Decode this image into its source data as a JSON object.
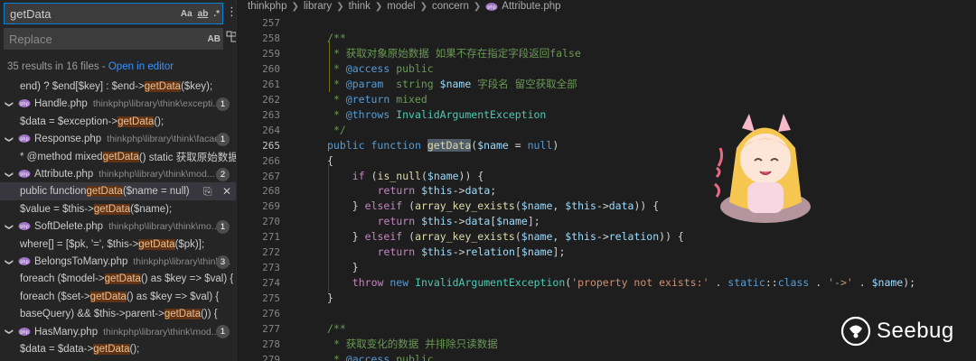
{
  "search": {
    "query": "getData",
    "replace_placeholder": "Replace",
    "toggle_case": "Aa",
    "toggle_word": "ab",
    "toggle_regex": ".*",
    "toggle_preserve_case": "AB",
    "summary": "35 results in 16 files - ",
    "open_in_editor": "Open in editor"
  },
  "results": [
    {
      "kind": "match",
      "pre": "end) ? $end[$key] : $end->",
      "hit": "getData",
      "post": "($key);"
    },
    {
      "kind": "file",
      "name": "Handle.php",
      "path": "thinkphp\\library\\think\\excepti...",
      "count": "1"
    },
    {
      "kind": "match",
      "pre": "$data = $exception->",
      "hit": "getData",
      "post": "();"
    },
    {
      "kind": "file",
      "name": "Response.php",
      "path": "thinkphp\\library\\think\\facade",
      "count": "1"
    },
    {
      "kind": "match",
      "pre": "* @method mixed ",
      "hit": "getData",
      "post": "() static 获取原始数据"
    },
    {
      "kind": "file",
      "name": "Attribute.php",
      "path": "thinkphp\\library\\think\\mod...",
      "count": "2"
    },
    {
      "kind": "match",
      "pre": "public function ",
      "hit": "getData",
      "post": "($name = null)",
      "selected": true
    },
    {
      "kind": "match",
      "pre": "$value    = $this->",
      "hit": "getData",
      "post": "($name);"
    },
    {
      "kind": "file",
      "name": "SoftDelete.php",
      "path": "thinkphp\\library\\think\\mo...",
      "count": "1"
    },
    {
      "kind": "match",
      "pre": "where[] = [$pk, '=', $this->",
      "hit": "getData",
      "post": "($pk)];"
    },
    {
      "kind": "file",
      "name": "BelongsToMany.php",
      "path": "thinkphp\\library\\think\\...",
      "count": "3"
    },
    {
      "kind": "match",
      "pre": "foreach ($model->",
      "hit": "getData",
      "post": "() as $key => $val) {"
    },
    {
      "kind": "match",
      "pre": "foreach ($set->",
      "hit": "getData",
      "post": "() as $key => $val) {"
    },
    {
      "kind": "match",
      "pre": "baseQuery) && $this->parent->",
      "hit": "getData",
      "post": "()) {"
    },
    {
      "kind": "file",
      "name": "HasMany.php",
      "path": "thinkphp\\library\\think\\mod...",
      "count": "1"
    },
    {
      "kind": "match",
      "pre": "$data = $data->",
      "hit": "getData",
      "post": "();"
    }
  ],
  "breadcrumb": [
    "thinkphp",
    "library",
    "think",
    "model",
    "concern",
    "Attribute.php"
  ],
  "editor": {
    "current_line": "265",
    "lines": [
      {
        "n": "257",
        "t": []
      },
      {
        "n": "258",
        "i": 0,
        "t": [
          [
            "cm",
            "/**"
          ]
        ]
      },
      {
        "n": "259",
        "i": 1,
        "t": [
          [
            "cm",
            "* 获取对象原始数据 如果不存在指定字段返回false"
          ]
        ]
      },
      {
        "n": "260",
        "i": 1,
        "t": [
          [
            "cm",
            "* "
          ],
          [
            "tg",
            "@access"
          ],
          [
            "cm",
            " public"
          ]
        ]
      },
      {
        "n": "261",
        "i": 1,
        "t": [
          [
            "cm",
            "* "
          ],
          [
            "tg",
            "@param"
          ],
          [
            "cm",
            "  string "
          ],
          [
            "vr",
            "$name"
          ],
          [
            "cm",
            " 字段名 留空获取全部"
          ]
        ]
      },
      {
        "n": "262",
        "i": 1,
        "t": [
          [
            "cm",
            "* "
          ],
          [
            "tg",
            "@return"
          ],
          [
            "cm",
            " mixed"
          ]
        ]
      },
      {
        "n": "263",
        "i": 1,
        "t": [
          [
            "cm",
            "* "
          ],
          [
            "tg",
            "@throws"
          ],
          [
            "ty",
            " InvalidArgumentException"
          ]
        ]
      },
      {
        "n": "264",
        "i": 1,
        "t": [
          [
            "cm",
            "*/"
          ]
        ]
      },
      {
        "n": "265",
        "i": 0,
        "t": [
          [
            "kw",
            "public"
          ],
          [
            "",
            " "
          ],
          [
            "kw",
            "function"
          ],
          [
            "",
            " "
          ],
          [
            "fn getdata-hl",
            "getData"
          ],
          [
            "",
            "("
          ],
          [
            "vr",
            "$name"
          ],
          [
            "",
            " = "
          ],
          [
            "kw",
            "null"
          ],
          [
            "",
            ")"
          ]
        ]
      },
      {
        "n": "266",
        "i": 0,
        "t": [
          [
            "",
            "{"
          ]
        ]
      },
      {
        "n": "267",
        "i": 4,
        "t": [
          [
            "ctl",
            "if"
          ],
          [
            "",
            " ("
          ],
          [
            "fn",
            "is_null"
          ],
          [
            "",
            "("
          ],
          [
            "vr",
            "$name"
          ],
          [
            "",
            ")) {"
          ]
        ]
      },
      {
        "n": "268",
        "i": 8,
        "t": [
          [
            "ctl",
            "return"
          ],
          [
            "",
            " "
          ],
          [
            "vr",
            "$this"
          ],
          [
            "",
            "->"
          ],
          [
            "vr",
            "data"
          ],
          [
            "",
            ";"
          ]
        ]
      },
      {
        "n": "269",
        "i": 4,
        "t": [
          [
            "",
            "} "
          ],
          [
            "ctl",
            "elseif"
          ],
          [
            "",
            " ("
          ],
          [
            "fn",
            "array_key_exists"
          ],
          [
            "",
            "("
          ],
          [
            "vr",
            "$name"
          ],
          [
            "",
            ", "
          ],
          [
            "vr",
            "$this"
          ],
          [
            "",
            "->"
          ],
          [
            "vr",
            "data"
          ],
          [
            "",
            ")) {"
          ]
        ]
      },
      {
        "n": "270",
        "i": 8,
        "t": [
          [
            "ctl",
            "return"
          ],
          [
            "",
            " "
          ],
          [
            "vr",
            "$this"
          ],
          [
            "",
            "->"
          ],
          [
            "vr",
            "data"
          ],
          [
            "",
            "["
          ],
          [
            "vr",
            "$name"
          ],
          [
            "",
            "];"
          ]
        ]
      },
      {
        "n": "271",
        "i": 4,
        "t": [
          [
            "",
            "} "
          ],
          [
            "ctl",
            "elseif"
          ],
          [
            "",
            " ("
          ],
          [
            "fn",
            "array_key_exists"
          ],
          [
            "",
            "("
          ],
          [
            "vr",
            "$name"
          ],
          [
            "",
            ", "
          ],
          [
            "vr",
            "$this"
          ],
          [
            "",
            "->"
          ],
          [
            "vr",
            "relation"
          ],
          [
            "",
            ")) {"
          ]
        ]
      },
      {
        "n": "272",
        "i": 8,
        "t": [
          [
            "ctl",
            "return"
          ],
          [
            "",
            " "
          ],
          [
            "vr",
            "$this"
          ],
          [
            "",
            "->"
          ],
          [
            "vr",
            "relation"
          ],
          [
            "",
            "["
          ],
          [
            "vr",
            "$name"
          ],
          [
            "",
            "];"
          ]
        ]
      },
      {
        "n": "273",
        "i": 4,
        "t": [
          [
            "",
            "}"
          ]
        ]
      },
      {
        "n": "274",
        "i": 4,
        "t": [
          [
            "ctl",
            "throw"
          ],
          [
            "",
            " "
          ],
          [
            "kw",
            "new"
          ],
          [
            "",
            " "
          ],
          [
            "ty",
            "InvalidArgumentException"
          ],
          [
            "",
            "("
          ],
          [
            "st",
            "'property not exists:'"
          ],
          [
            "",
            " . "
          ],
          [
            "kw",
            "static"
          ],
          [
            "",
            "::"
          ],
          [
            "kw",
            "class"
          ],
          [
            "",
            " . "
          ],
          [
            "st",
            "'->'"
          ],
          [
            "",
            " . "
          ],
          [
            "vr",
            "$name"
          ],
          [
            "",
            ");"
          ]
        ]
      },
      {
        "n": "275",
        "i": 0,
        "t": [
          [
            "",
            "}"
          ]
        ]
      },
      {
        "n": "276",
        "t": []
      },
      {
        "n": "277",
        "i": 0,
        "t": [
          [
            "cm",
            "/**"
          ]
        ]
      },
      {
        "n": "278",
        "i": 1,
        "t": [
          [
            "cm",
            "* 获取变化的数据 并排除只读数据"
          ]
        ]
      },
      {
        "n": "279",
        "i": 1,
        "t": [
          [
            "cm",
            "* "
          ],
          [
            "tg",
            "@access"
          ],
          [
            "cm",
            " public"
          ]
        ]
      }
    ]
  },
  "watermark": {
    "text": "Seebug"
  },
  "colors": {
    "accent": "#007fd4",
    "match_highlight": "#613214",
    "link": "#3794ff"
  }
}
